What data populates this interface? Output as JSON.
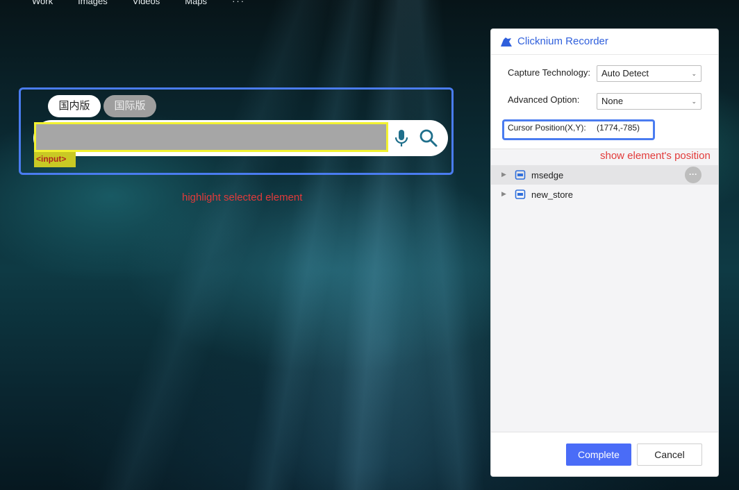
{
  "background": {
    "nav": [
      "Work",
      "Images",
      "Videos",
      "Maps",
      "···"
    ],
    "search": {
      "tabs": [
        "国内版",
        "国际版"
      ],
      "selected_tag": "<input>",
      "mic_icon": "mic-icon",
      "search_icon": "search-icon"
    },
    "caption": "highlight selected element",
    "colors": {
      "highlight_border": "#4a7cf0",
      "selected_border": "#f2f230",
      "caption": "#e23a3a"
    }
  },
  "recorder": {
    "title": "Clicknium Recorder",
    "logo_icon": "clicknium-logo-icon",
    "capture_technology": {
      "label": "Capture Technology:",
      "value": "Auto Detect"
    },
    "advanced_option": {
      "label": "Advanced Option:",
      "value": "None"
    },
    "cursor_position": {
      "label": "Cursor Position(X,Y):",
      "value": "(1774,-785)"
    },
    "caption": "show element's position",
    "tree": [
      {
        "label": "msedge",
        "icon": "store-icon",
        "more": "···"
      },
      {
        "label": "new_store",
        "icon": "store-icon"
      }
    ],
    "buttons": {
      "complete": "Complete",
      "cancel": "Cancel"
    },
    "colors": {
      "accent": "#4a6cf7",
      "title": "#2f5fdc"
    }
  }
}
